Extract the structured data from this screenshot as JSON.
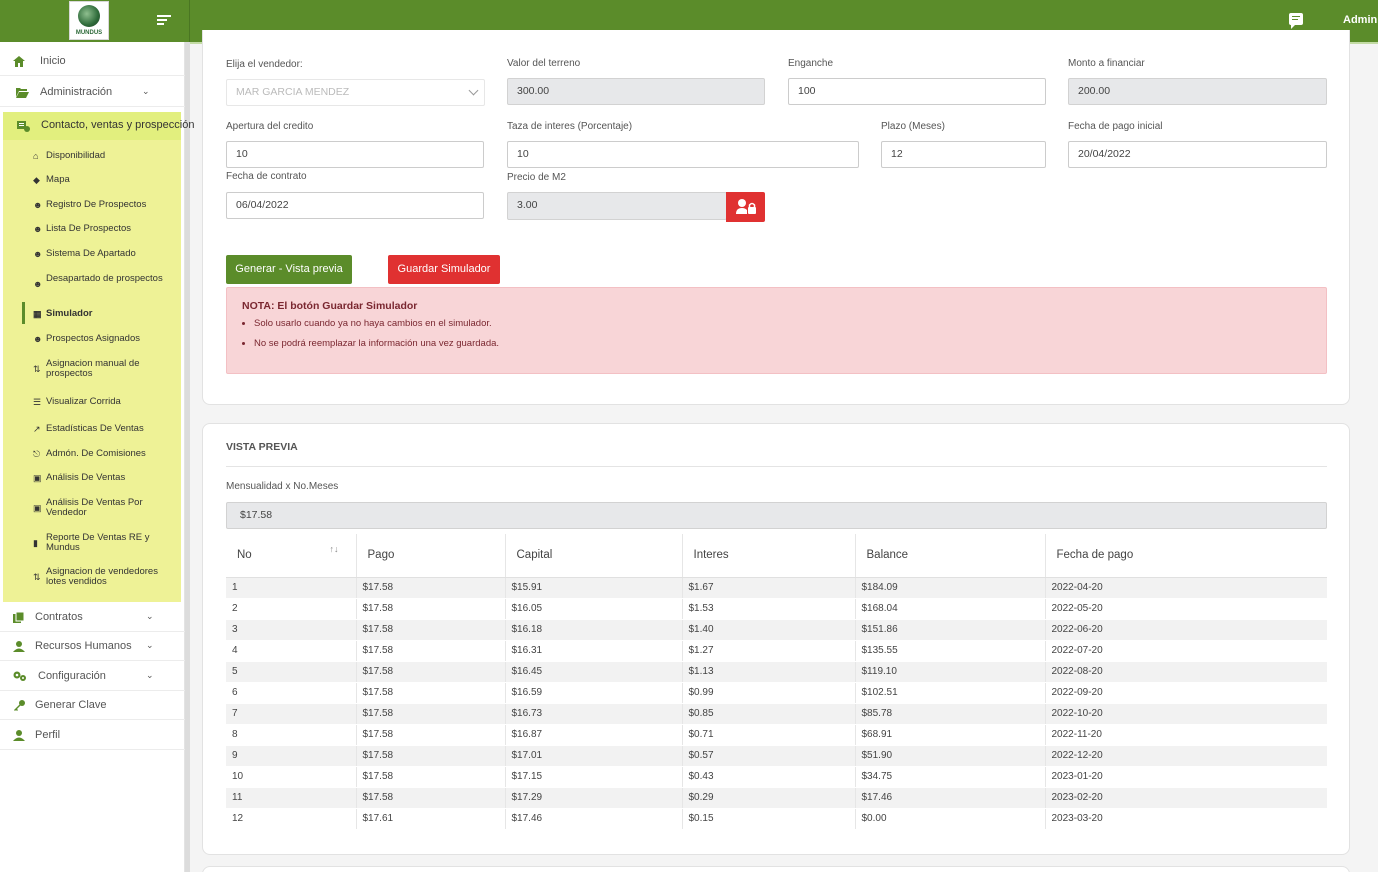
{
  "header": {
    "logo_text": "MUNDUS",
    "user_name": "Adminis"
  },
  "sidebar": {
    "items": [
      {
        "label": "Inicio"
      },
      {
        "label": "Administración"
      },
      {
        "label": "Contacto, ventas y prospección"
      },
      {
        "label": "Contratos"
      },
      {
        "label": "Recursos Humanos"
      },
      {
        "label": "Configuración"
      },
      {
        "label": "Generar Clave"
      },
      {
        "label": "Perfil"
      }
    ],
    "subitems": [
      {
        "label": "Disponibilidad"
      },
      {
        "label": "Mapa"
      },
      {
        "label": "Registro De Prospectos"
      },
      {
        "label": "Lista De Prospectos"
      },
      {
        "label": "Sistema De Apartado"
      },
      {
        "label": "Desapartado de prospectos"
      },
      {
        "label": "Simulador"
      },
      {
        "label": "Prospectos Asignados"
      },
      {
        "label": "Asignacion manual de prospectos"
      },
      {
        "label": "Visualizar Corrida"
      },
      {
        "label": "Estadísticas De Ventas"
      },
      {
        "label": "Admón. De Comisiones"
      },
      {
        "label": "Análisis De Ventas"
      },
      {
        "label": "Análisis De Ventas Por Vendedor"
      },
      {
        "label": "Reporte De Ventas RE y Mundus"
      },
      {
        "label": "Asignacion de vendedores lotes vendidos"
      }
    ]
  },
  "form": {
    "vendedor": {
      "label": "Elija el vendedor:",
      "value": "MAR GARCIA MENDEZ"
    },
    "valor_terreno": {
      "label": "Valor del terreno",
      "value": "300.00"
    },
    "enganche": {
      "label": "Enganche",
      "value": "100"
    },
    "monto_financiar": {
      "label": "Monto a financiar",
      "value": "200.00"
    },
    "apertura_credito": {
      "label": "Apertura del credito",
      "value": "10"
    },
    "tasa_interes": {
      "label": "Taza de interes (Porcentaje)",
      "value": "10"
    },
    "plazo": {
      "label": "Plazo (Meses)",
      "value": "12"
    },
    "fecha_pago_inicial": {
      "label": "Fecha de pago inicial",
      "value": "20/04/2022"
    },
    "fecha_contrato": {
      "label": "Fecha de contrato",
      "value": "06/04/2022"
    },
    "precio_m2": {
      "label": "Precio de M2",
      "value": "3.00"
    }
  },
  "buttons": {
    "generar": "Generar - Vista previa",
    "guardar": "Guardar Simulador"
  },
  "alert": {
    "title": "NOTA: El botón Guardar Simulador",
    "lines": [
      "Solo usarlo cuando ya no haya cambios en el simulador.",
      "No se podrá reemplazar la información una vez guardada."
    ]
  },
  "preview": {
    "title": "VISTA PREVIA",
    "mensualidad_label": "Mensualidad x No.Meses",
    "mensualidad_value": "$17.58"
  },
  "table": {
    "headers": [
      "No",
      "Pago",
      "Capital",
      "Interes",
      "Balance",
      "Fecha de pago"
    ],
    "rows": [
      [
        "1",
        "$17.58",
        "$15.91",
        "$1.67",
        "$184.09",
        "2022-04-20"
      ],
      [
        "2",
        "$17.58",
        "$16.05",
        "$1.53",
        "$168.04",
        "2022-05-20"
      ],
      [
        "3",
        "$17.58",
        "$16.18",
        "$1.40",
        "$151.86",
        "2022-06-20"
      ],
      [
        "4",
        "$17.58",
        "$16.31",
        "$1.27",
        "$135.55",
        "2022-07-20"
      ],
      [
        "5",
        "$17.58",
        "$16.45",
        "$1.13",
        "$119.10",
        "2022-08-20"
      ],
      [
        "6",
        "$17.58",
        "$16.59",
        "$0.99",
        "$102.51",
        "2022-09-20"
      ],
      [
        "7",
        "$17.58",
        "$16.73",
        "$0.85",
        "$85.78",
        "2022-10-20"
      ],
      [
        "8",
        "$17.58",
        "$16.87",
        "$0.71",
        "$68.91",
        "2022-11-20"
      ],
      [
        "9",
        "$17.58",
        "$17.01",
        "$0.57",
        "$51.90",
        "2022-12-20"
      ],
      [
        "10",
        "$17.58",
        "$17.15",
        "$0.43",
        "$34.75",
        "2023-01-20"
      ],
      [
        "11",
        "$17.58",
        "$17.29",
        "$0.29",
        "$17.46",
        "2023-02-20"
      ],
      [
        "12",
        "$17.61",
        "$17.46",
        "$0.15",
        "$0.00",
        "2023-03-20"
      ]
    ]
  },
  "colors": {
    "brand_green": "#5b8c2a",
    "danger_red": "#e03131",
    "submenu_highlight": "#eef296"
  }
}
